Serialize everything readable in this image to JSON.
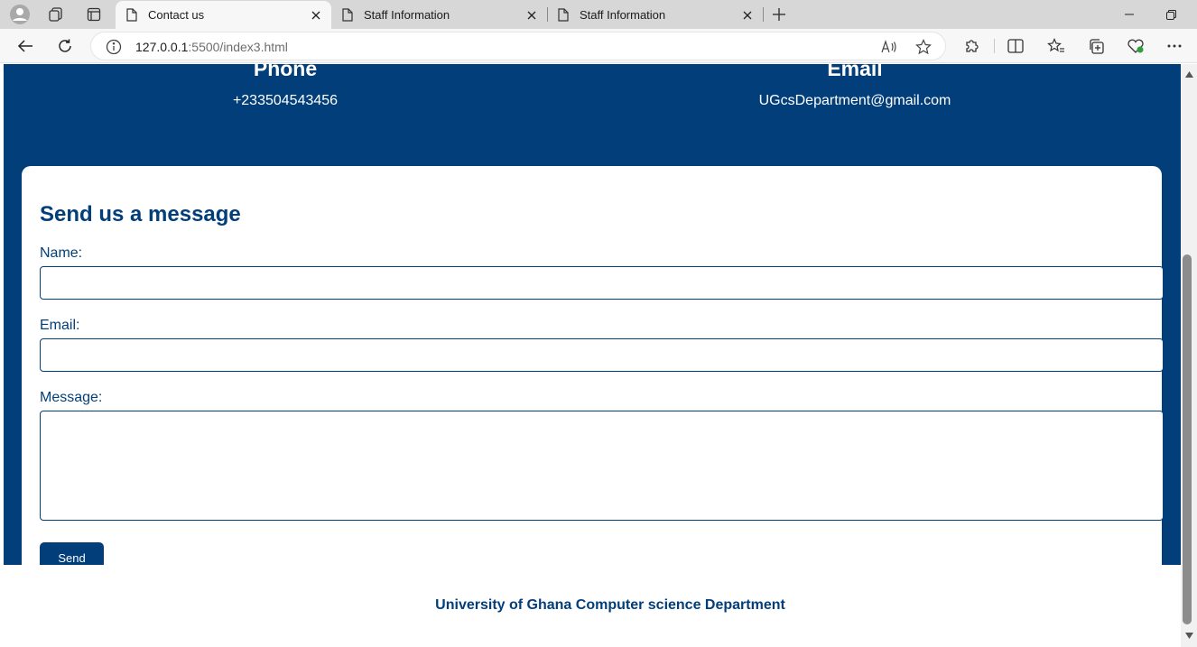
{
  "browser": {
    "tabs": [
      {
        "title": "Contact us",
        "active": true
      },
      {
        "title": "Staff Information",
        "active": false
      },
      {
        "title": "Staff Information",
        "active": false
      }
    ],
    "url_host": "127.0.0.1",
    "url_rest": ":5500/index3.html"
  },
  "contact": {
    "phone_heading": "Phone",
    "phone_value": "+233504543456",
    "email_heading": "Email",
    "email_value": "UGcsDepartment@gmail.com"
  },
  "form": {
    "heading": "Send us a message",
    "name_label": "Name:",
    "email_label": "Email:",
    "message_label": "Message:",
    "name_value": "",
    "email_value": "",
    "message_value": "",
    "send_label": "Send"
  },
  "footer": {
    "text": "University of Ghana Computer science Department"
  },
  "colors": {
    "brand_blue": "#023f7a",
    "white": "#ffffff"
  }
}
